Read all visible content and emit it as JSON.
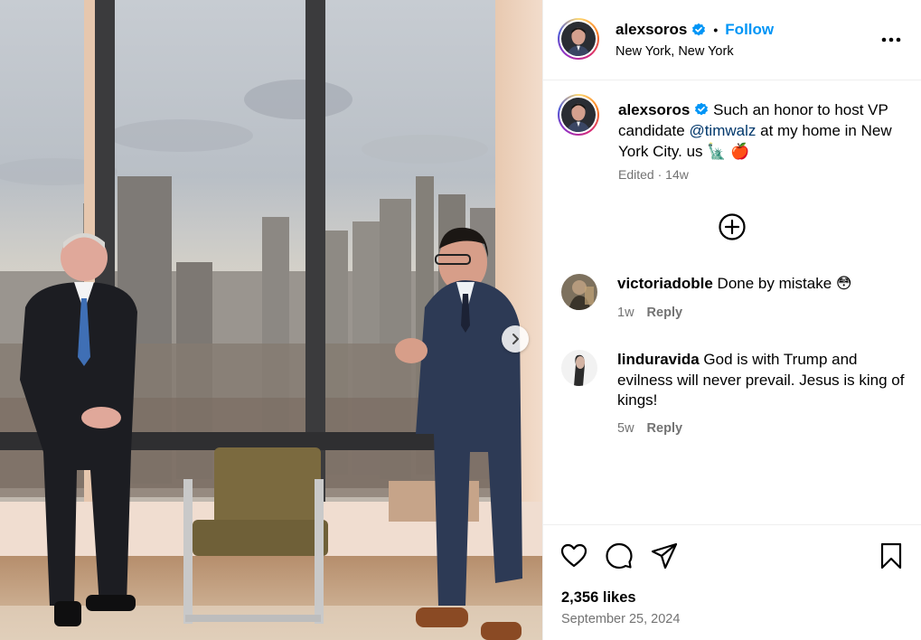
{
  "post": {
    "author": {
      "username": "alexsoros",
      "verified": true,
      "follow_label": "Follow",
      "separator": "•",
      "location": "New York, New York"
    },
    "caption": {
      "text_before": " Such an honor to host VP candidate ",
      "mention": "@timwalz",
      "text_after": " at my home in New York City. us 🗽 🍎",
      "edited": "Edited",
      "age": "14w"
    },
    "comments": [
      {
        "username": "victoriadoble",
        "text": " Done by mistake 😳",
        "age": "1w",
        "reply_label": "Reply"
      },
      {
        "username": "linduravida",
        "text": " God is with Trump and evilness will never prevail. Jesus is king of kings!",
        "age": "5w",
        "reply_label": "Reply"
      }
    ],
    "likes": "2,356 likes",
    "date": "September 25, 2024"
  },
  "icons": {
    "verified": "verified-badge-icon",
    "more": "more-options-icon",
    "load_more": "add-circle-icon",
    "like": "heart-icon",
    "comment": "comment-bubble-icon",
    "share": "paper-plane-icon",
    "save": "bookmark-icon",
    "carousel_next": "chevron-right-icon"
  },
  "colors": {
    "follow": "#0095f6",
    "verified": "#0095f6",
    "mention": "#00376b",
    "muted": "#737373",
    "divider": "#efefef"
  }
}
